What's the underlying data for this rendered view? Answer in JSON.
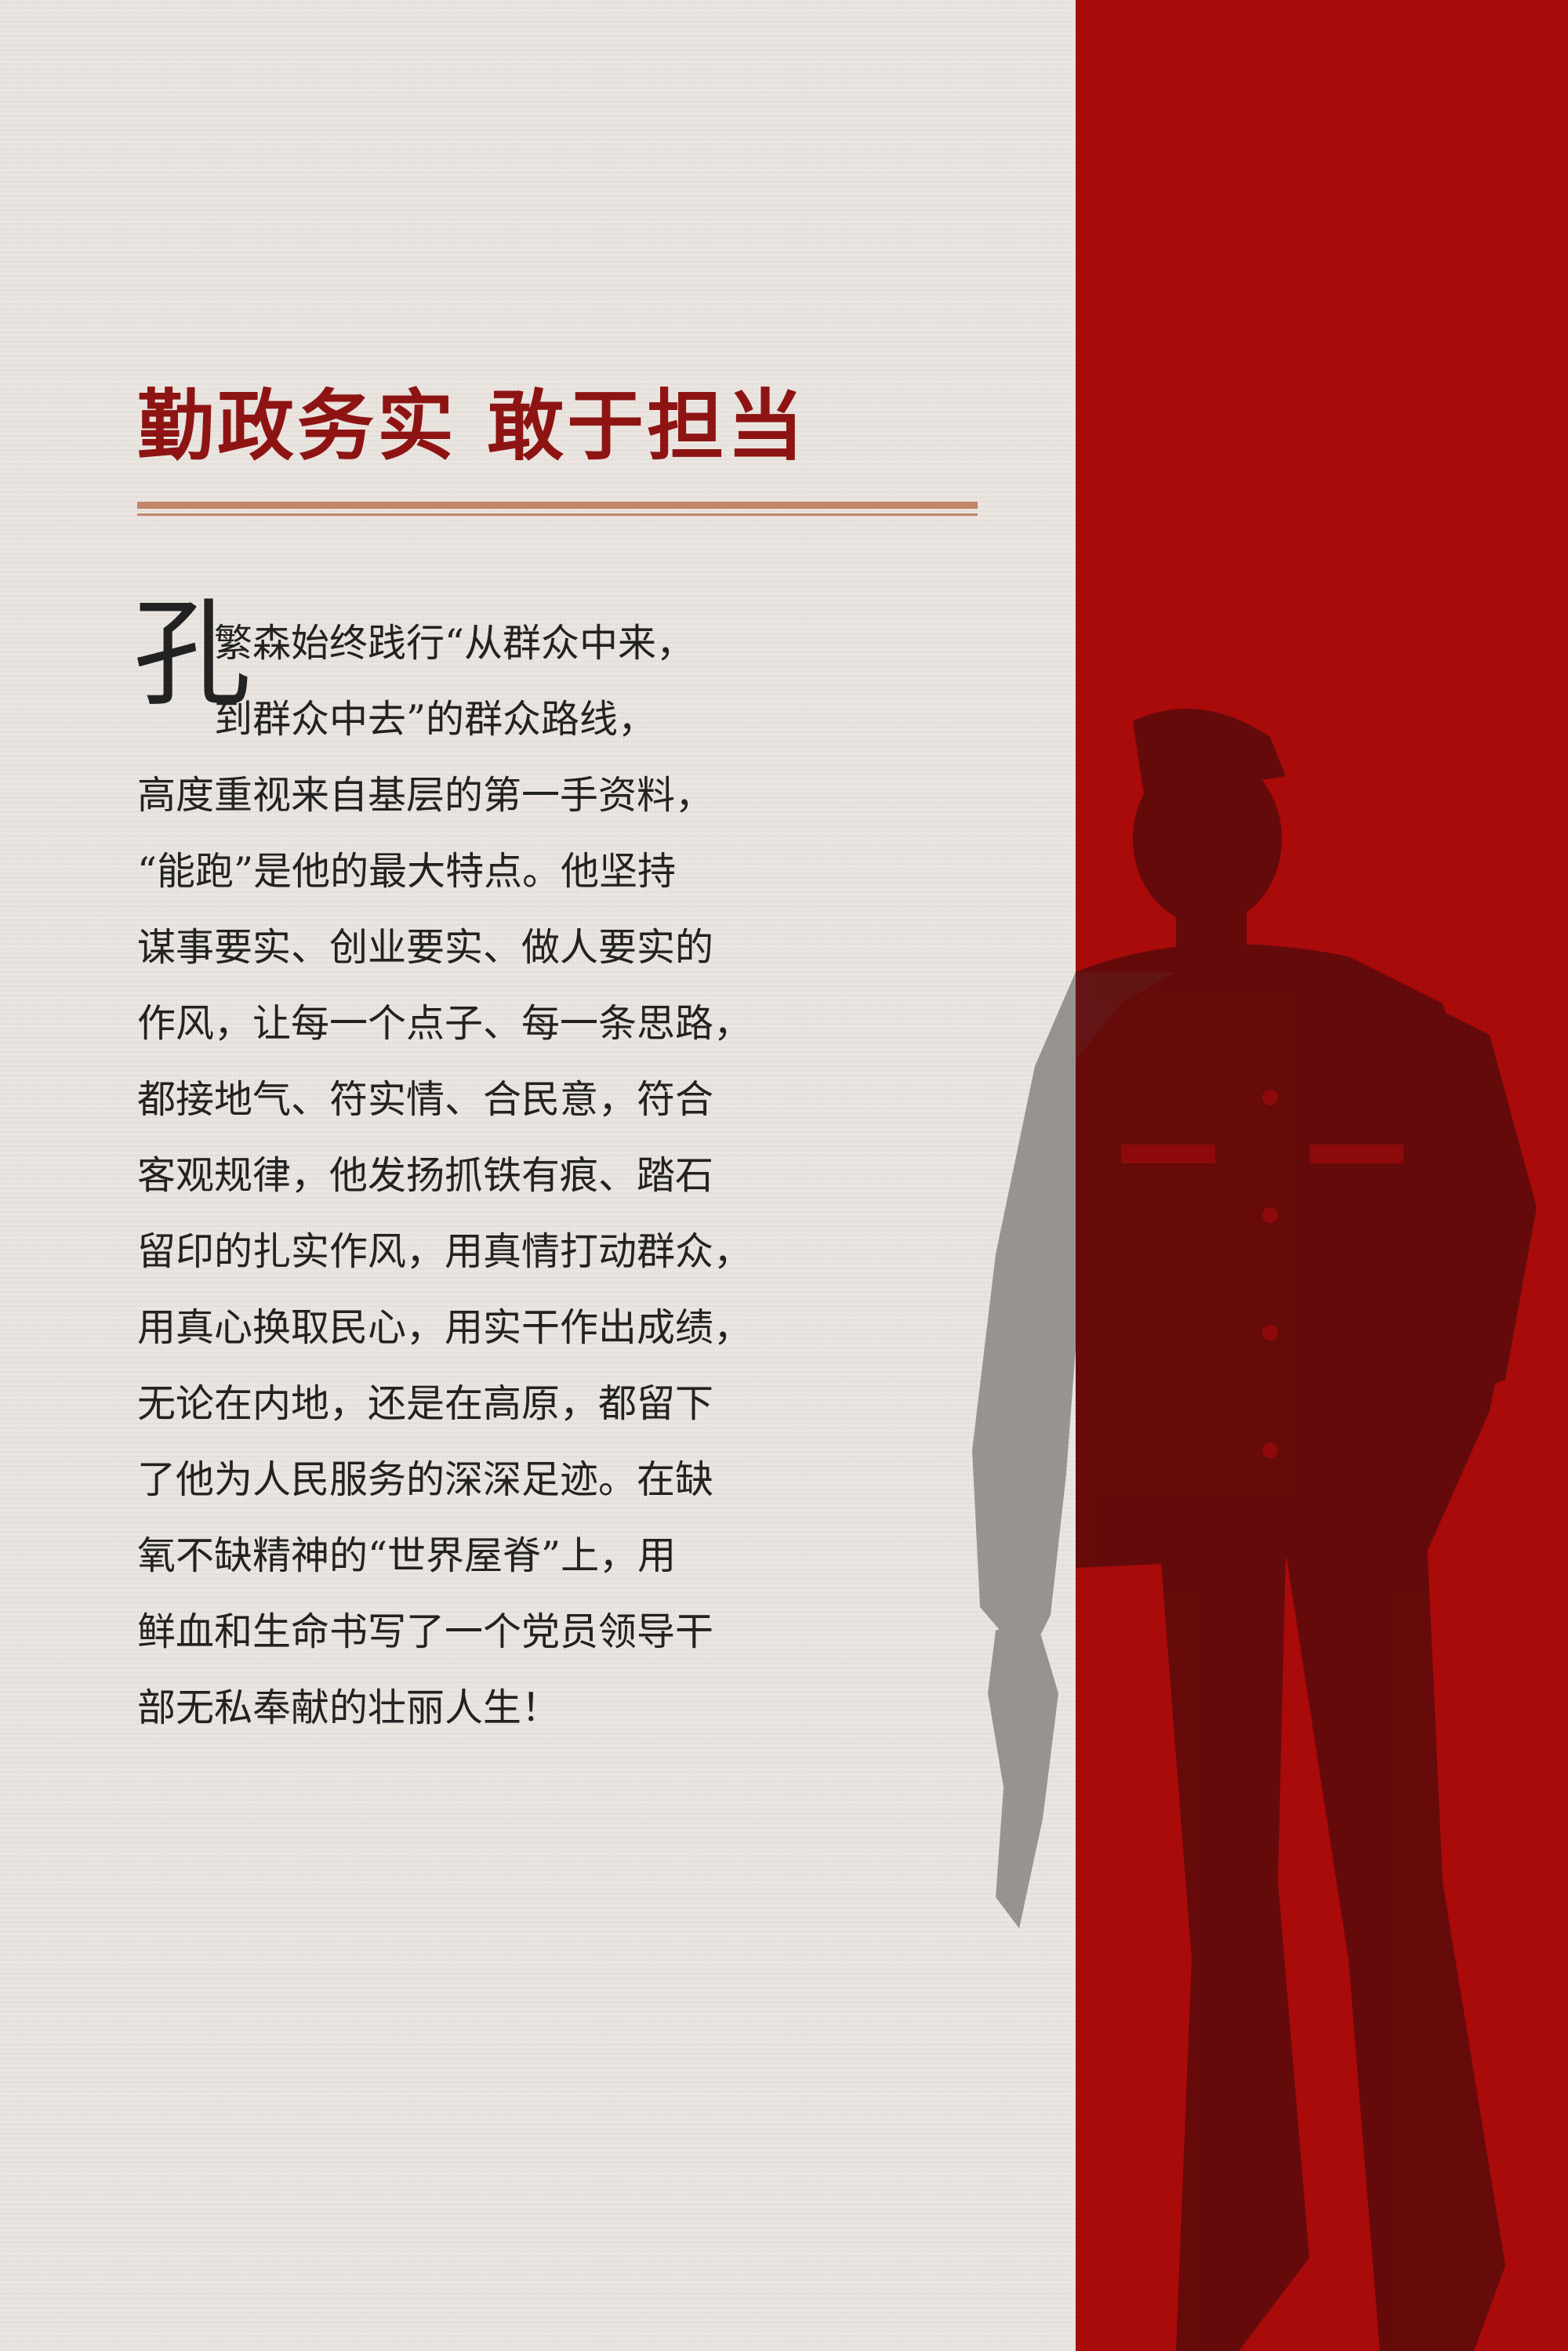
{
  "title": "勤政务实 敢于担当",
  "dropcap": "孔",
  "body_lines": "　　繁森始终践行“从群众中来，\n　　到群众中去”的群众路线，\n高度重视来自基层的第一手资料，\n“能跑”是他的最大特点。他坚持\n谋事要实、创业要实、做人要实的\n作风，让每一个点子、每一条思路，\n都接地气、符实情、合民意，符合\n客观规律，他发扬抓铁有痕、踏石\n留印的扎实作风，用真情打动群众，\n用真心换取民心，用实干作出成绩，\n无论在内地，还是在高原，都留下\n了他为人民服务的深深足迹。在缺\n氧不缺精神的“世界屋脊”上，用\n鲜血和生命书写了一个党员领导干\n部无私奉献的壮丽人生！",
  "colors": {
    "paper": "#ebe6e1",
    "red_panel": "#a90a0a",
    "title": "#8e1414",
    "rule": "#c2866a",
    "figure_dark": "#5e0a0a",
    "figure_light": "#8a8580"
  },
  "icons": {
    "figure": "standing-man-silhouette"
  }
}
